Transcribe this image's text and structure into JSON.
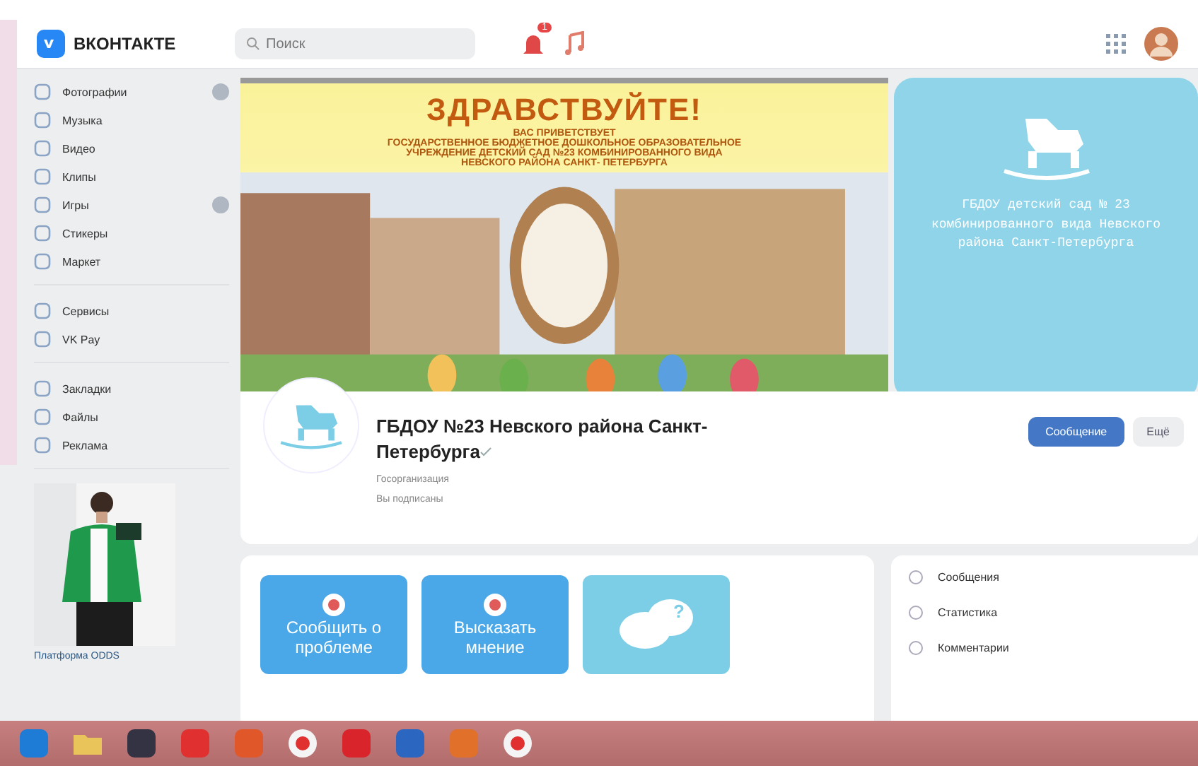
{
  "header": {
    "logo": "ВКОНТАКТЕ",
    "search": {
      "placeholder": "Поиск"
    },
    "notification_badge": "1"
  },
  "sidebar": {
    "groups": [
      [
        {
          "label": "Фотографии",
          "counter": true
        },
        {
          "label": "Музыка",
          "counter": false
        },
        {
          "label": "Видео",
          "counter": false
        },
        {
          "label": "Клипы",
          "counter": false
        },
        {
          "label": "Игры",
          "counter": true
        },
        {
          "label": "Стикеры",
          "counter": false
        },
        {
          "label": "Маркет",
          "counter": false
        }
      ],
      [
        {
          "label": "Сервисы",
          "counter": false
        },
        {
          "label": "VK Pay",
          "counter": false
        }
      ],
      [
        {
          "label": "Закладки",
          "counter": false
        },
        {
          "label": "Файлы",
          "counter": false
        },
        {
          "label": "Реклама",
          "counter": false
        }
      ]
    ],
    "ad": {
      "kind": "picture",
      "caption": "Платформа ODDS"
    }
  },
  "cover": {
    "title": "ЗДРАВСТВУЙТЕ!",
    "lines": [
      "ВАС ПРИВЕТСТВУЕТ",
      "ГОСУДАРСТВЕННОЕ БЮДЖЕТНОЕ ДОШКОЛЬНОЕ ОБРАЗОВАТЕЛЬНОЕ",
      "УЧРЕЖДЕНИЕ ДЕТСКИЙ САД №23 КОМБИНИРОВАННОГО ВИДА",
      "НЕВСКОГО РАЙОНА САНКТ- ПЕТЕРБУРГА"
    ]
  },
  "side_card": {
    "text": "ГБДОУ детский сад № 23 комбинированного вида Невского района Санкт-Петербурга"
  },
  "profile": {
    "name": "ГБДОУ №23 Невского района Санкт-Петербурга",
    "verified": true,
    "category": "Госорганизация",
    "subscribed": "Вы подписаны",
    "buttons": [
      "Сообщение",
      "Ещё"
    ]
  },
  "tiles": [
    {
      "kind": "text",
      "label": "Сообщить о проблеме",
      "color": "#4aa8e8"
    },
    {
      "kind": "text",
      "label": "Высказать мнение",
      "color": "#4aa8e8"
    },
    {
      "kind": "question",
      "label": "?",
      "color": "#7ccde6"
    }
  ],
  "admin_menu": [
    "Сообщения",
    "Статистика",
    "Комментарии"
  ],
  "taskbar": {
    "apps": [
      {
        "kind": "ie"
      },
      {
        "kind": "folder"
      },
      {
        "kind": "media"
      },
      {
        "kind": "yandex"
      },
      {
        "kind": "office"
      },
      {
        "kind": "ybrowser"
      },
      {
        "kind": "opera"
      },
      {
        "kind": "word"
      },
      {
        "kind": "slides"
      },
      {
        "kind": "ybrowser"
      }
    ]
  }
}
